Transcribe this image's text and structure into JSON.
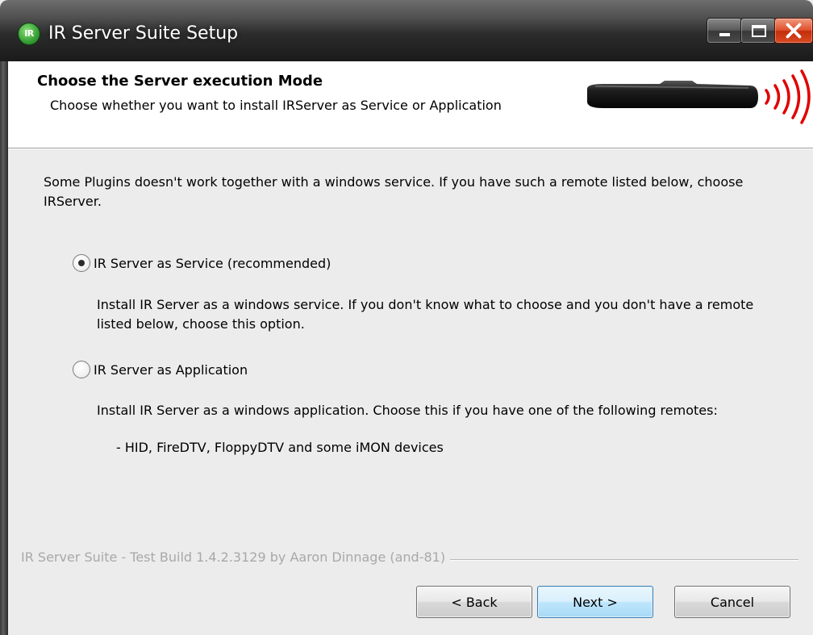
{
  "window": {
    "app_icon_text": "IR",
    "title": "IR Server Suite Setup"
  },
  "header": {
    "title": "Choose the Server execution Mode",
    "subtitle": "Choose whether you want to install IRServer as Service or Application"
  },
  "body": {
    "intro": "Some Plugins doesn't work together with a windows service. If you have such a remote listed below, choose IRServer.",
    "options": [
      {
        "label": "IR Server as Service (recommended)",
        "checked": true,
        "description": "Install IR Server as a windows service. If you don't know what to choose and you don't have a remote listed below, choose this option."
      },
      {
        "label": "IR Server as Application",
        "checked": false,
        "description": "Install IR Server as a windows application. Choose this if you have one of the following remotes:",
        "list_item": "- HID, FireDTV, FloppyDTV and some iMON devices"
      }
    ]
  },
  "branding": "IR Server Suite - Test Build 1.4.2.3129 by Aaron Dinnage (and-81)",
  "buttons": {
    "back": "< Back",
    "next": "Next >",
    "cancel": "Cancel"
  },
  "colors": {
    "close_button": "#d84a22",
    "default_button": "#bee6fd",
    "ir_signal": "#e00000"
  }
}
